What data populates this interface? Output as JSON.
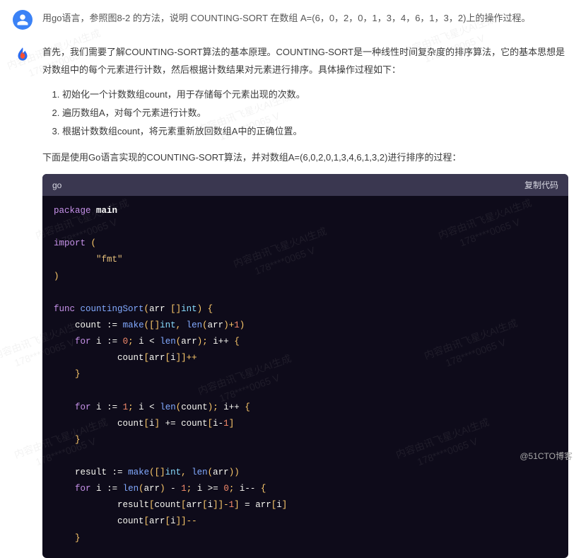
{
  "user": {
    "message": "用go语言，参照图8-2 的方法，说明 COUNTING-SORT 在数组 A=(6，0，2，0，1，3，4，6，1，3，2)上的操作过程。"
  },
  "ai": {
    "para1": "首先，我们需要了解COUNTING-SORT算法的基本原理。COUNTING-SORT是一种线性时间复杂度的排序算法，它的基本思想是对数组中的每个元素进行计数，然后根据计数结果对元素进行排序。具体操作过程如下：",
    "steps": [
      "初始化一个计数数组count，用于存储每个元素出现的次数。",
      "遍历数组A，对每个元素进行计数。",
      "根据计数数组count，将元素重新放回数组A中的正确位置。"
    ],
    "para2": "下面是使用Go语言实现的COUNTING-SORT算法，并对数组A=(6,0,2,0,1,3,4,6,1,3,2)进行排序的过程：",
    "code": {
      "language": "go",
      "copy_label": "复制代码",
      "tokens": {
        "package": "package",
        "main": "main",
        "import": "import",
        "fmt": "\"fmt\"",
        "func": "func",
        "fn_name": "countingSort",
        "arr": "arr",
        "int_ty": "int",
        "for": "for",
        "make": "make",
        "len": "len",
        "count": "count",
        "result": "result",
        "i": "i",
        "zero": "0",
        "one": "1"
      }
    }
  },
  "watermark": {
    "line1": "内容由讯飞星火AI生成",
    "line2": "178****0065 V"
  },
  "footer": "@51CTO博客"
}
